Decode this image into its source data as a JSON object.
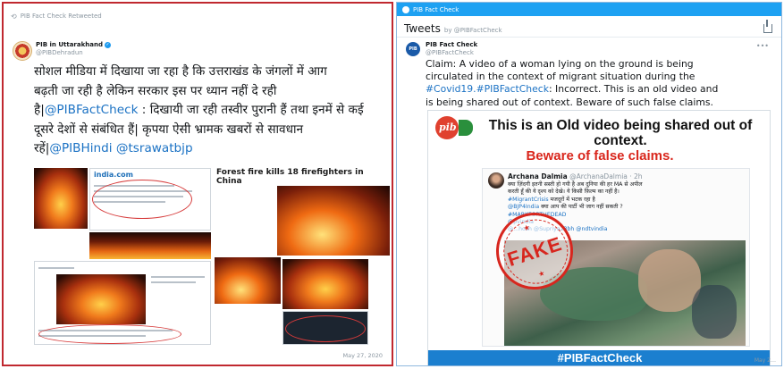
{
  "left": {
    "retweet_label": "PIB Fact Check Retweeted",
    "account_name": "PIB in Uttarakhand",
    "account_handle": "@PIBDehradun",
    "tweet_line_1": "सोशल मीडिया में दिखाया जा रहा है कि उत्तराखंड के जंगलों में आग",
    "tweet_line_2": "बढ़ती जा रही है लेकिन सरकार इस पर ध्यान नहीं दे रही",
    "tweet_line_3_pre": "है|",
    "tweet_link_1": "@PIBFactCheck",
    "tweet_line_3_post": " : दिखायी जा रही तस्वीर पुरानी हैं तथा इनमें से कई",
    "tweet_line_4": "दूसरे देशों से संबंधित हैं| कृपया ऐसी भ्रामक खबरों से सावधान",
    "tweet_line_5_pre": "रहें|",
    "tweet_link_2": "@PIBHindi",
    "tweet_link_3": "@tsrawatbjp",
    "news_headline": "Forest fire kills 18 firefighters in China",
    "site_name": "india.com",
    "timestamp": "May 27, 2020"
  },
  "right": {
    "topbar_label": "PIB Fact Check",
    "tweets_label": "Tweets",
    "tweets_by": "by @PIBFactCheck",
    "account_name": "PIB Fact Check",
    "account_handle": "@PIBFactCheck",
    "avatar_text": "PIB",
    "more_glyph": "•••",
    "claim_line_1": "Claim: A video of a woman lying on the ground is being",
    "claim_line_2": "circulated in the context of migrant situation during the",
    "claim_link": "#Covid19.#PIBFactCheck",
    "claim_line_3_post": ": Incorrect. This is an old video and",
    "claim_line_4": "is being shared out of context. Beware of such false claims.",
    "image": {
      "logo_text": "pib",
      "headline_1": "This is an Old video being shared out of context.",
      "headline_2": "Beware of false claims.",
      "inner_name": "Archana Dalmia",
      "inner_handle": "@ArchanaDalmia · 2h",
      "inner_text_1": "क्या ज़िंदगी इतनी सस्ती हो गयी है अब दुनिया की हर MA से अपील",
      "inner_text_2": "करती हूँ की ये दृश्य को देखे। ये किसी फ़िल्म का नहीं है।",
      "inner_link_1": "#MigrantCrisis",
      "inner_text_3": " मजदूरों में भटक रहा है",
      "inner_link_2": "@BJP4India",
      "inner_text_4": " क्या आप की पार्टी भी जाग नहीं सकती ?",
      "inner_link_3": "#MARKFORTHEDEAD",
      "inner_link_4": "@pvindia",
      "inner_link_5": "@...hosh @Supriya23bh @ndtvindia",
      "stamp_text": "FAKE",
      "banner_text": "#PIBFactCheck"
    },
    "timestamp": "May 2…"
  }
}
